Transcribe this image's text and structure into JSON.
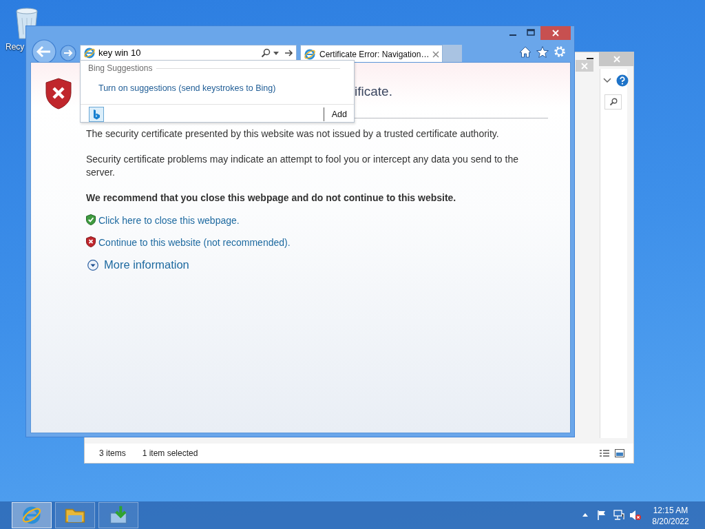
{
  "desktop": {
    "icons": [
      {
        "label": "Recy"
      }
    ]
  },
  "explorer": {
    "status_bar": {
      "item_count": "3 items",
      "selection": "1 item selected"
    }
  },
  "browser": {
    "address_bar": {
      "value": "key win 10"
    },
    "tabs": [
      {
        "label": "Certificate Error: Navigation…",
        "selected": true
      }
    ],
    "suggestions": {
      "header": "Bing Suggestions",
      "link": "Turn on suggestions (send keystrokes to Bing)",
      "add_button": "Add"
    },
    "page": {
      "heading": "ificate.",
      "paragraphs": [
        "The security certificate presented by this website was not issued by a trusted certificate authority.",
        "Security certificate problems may indicate an attempt to fool you or intercept any data you send to the server."
      ],
      "recommendation": "We recommend that you close this webpage and do not continue to this website.",
      "links": [
        {
          "kind": "safe",
          "label": "Click here to close this webpage."
        },
        {
          "kind": "unsafe",
          "label": "Continue to this website (not recommended)."
        }
      ],
      "more_info": "More information"
    }
  },
  "taskbar": {
    "buttons": [
      {
        "kind": "browser",
        "selected": true
      },
      {
        "kind": "folder",
        "selected": false
      },
      {
        "kind": "installer",
        "selected": false
      }
    ],
    "clock": {
      "time": "12:15 AM",
      "date": "8/20/2022"
    }
  }
}
